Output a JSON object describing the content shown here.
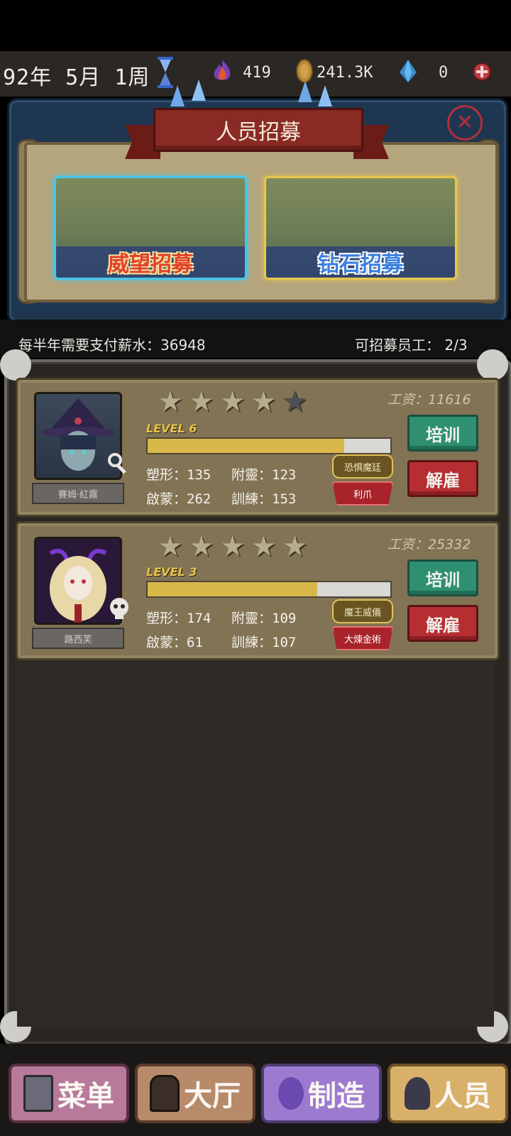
{
  "hud": {
    "date": "92年 5月 1周",
    "flame": "419",
    "coins": "241.3K",
    "gems": "0"
  },
  "recruit": {
    "title": "人员招募",
    "prestige_label": "威望招募",
    "diamond_label": "钻石招募"
  },
  "info": {
    "salary_text": "每半年需要支付薪水：36948",
    "capacity_text": "可招募员工：  2/3"
  },
  "staff": [
    {
      "name": "賽姆·紅霧",
      "wage": "工资：11616",
      "stars": 4,
      "level_label": "LEVEL",
      "level": "6",
      "exp_progress": 0.81,
      "stats": {
        "shape_label": "塑形：",
        "shape": "135",
        "attach_label": "附靈：",
        "attach": "123",
        "enlight_label": "啟蒙：",
        "enlight": "262",
        "train_label": "訓練：",
        "train": "153"
      },
      "trait_gold": "恐惧魔廷",
      "trait_red": "利爪",
      "train_btn": "培训",
      "fire_btn": "解雇"
    },
    {
      "name": "路西芙",
      "wage": "工资：25332",
      "stars": 5,
      "level_label": "LEVEL",
      "level": "3",
      "exp_progress": 0.7,
      "stats": {
        "shape_label": "塑形：",
        "shape": "174",
        "attach_label": "附靈：",
        "attach": "109",
        "enlight_label": "啟蒙：",
        "enlight": "61",
        "train_label": "訓練：",
        "train": "107"
      },
      "trait_gold": "魔王威儀",
      "trait_red": "大煉金術",
      "train_btn": "培训",
      "fire_btn": "解雇"
    }
  ],
  "nav": {
    "menu": "菜单",
    "hall": "大厅",
    "make": "制造",
    "staff": "人员"
  },
  "colors": {
    "panel_blue": "#1f3650",
    "train_green": "#2f8f71",
    "fire_red": "#b52e32",
    "exp_gold": "#d9b84a"
  }
}
